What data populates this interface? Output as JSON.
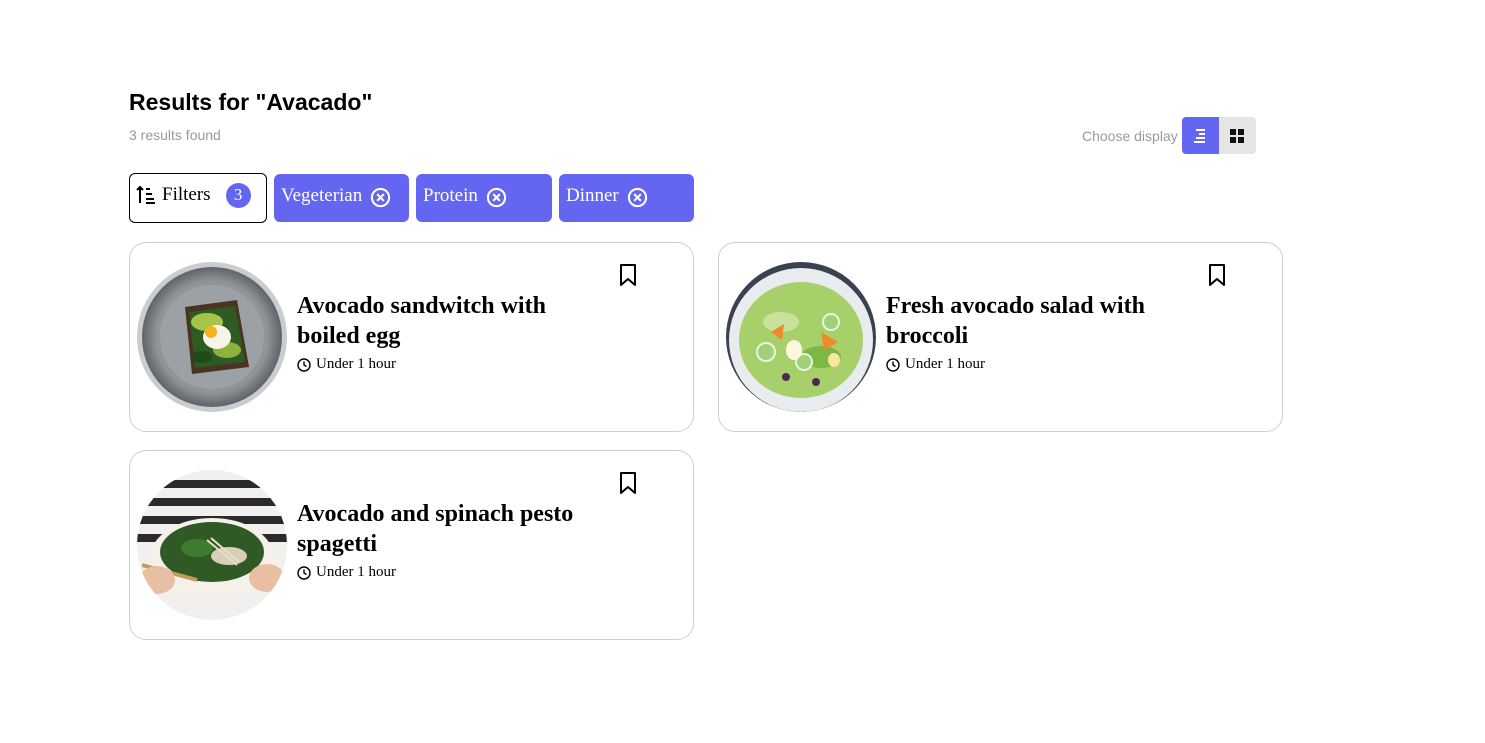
{
  "header": {
    "title": "Results for \"Avacado\"",
    "results_count": "3 results found"
  },
  "display": {
    "label": "Choose display",
    "options": [
      "list",
      "grid"
    ],
    "selected": "list",
    "accent_color": "#6466f1"
  },
  "filters": {
    "button_label": "Filters",
    "count": "3",
    "chips": [
      {
        "label": "Vegeterian"
      },
      {
        "label": "Protein"
      },
      {
        "label": "Dinner"
      }
    ]
  },
  "recipes": [
    {
      "title": "Avocado sandwitch with boiled egg",
      "time": "Under 1 hour",
      "image": "avocado-toast-photo"
    },
    {
      "title": "Fresh avocado salad with broccoli",
      "time": "Under 1 hour",
      "image": "salad-bowl-photo"
    },
    {
      "title": "Avocado and spinach pesto spagetti",
      "time": "Under 1 hour",
      "image": "spinach-pasta-bowl-photo"
    }
  ]
}
